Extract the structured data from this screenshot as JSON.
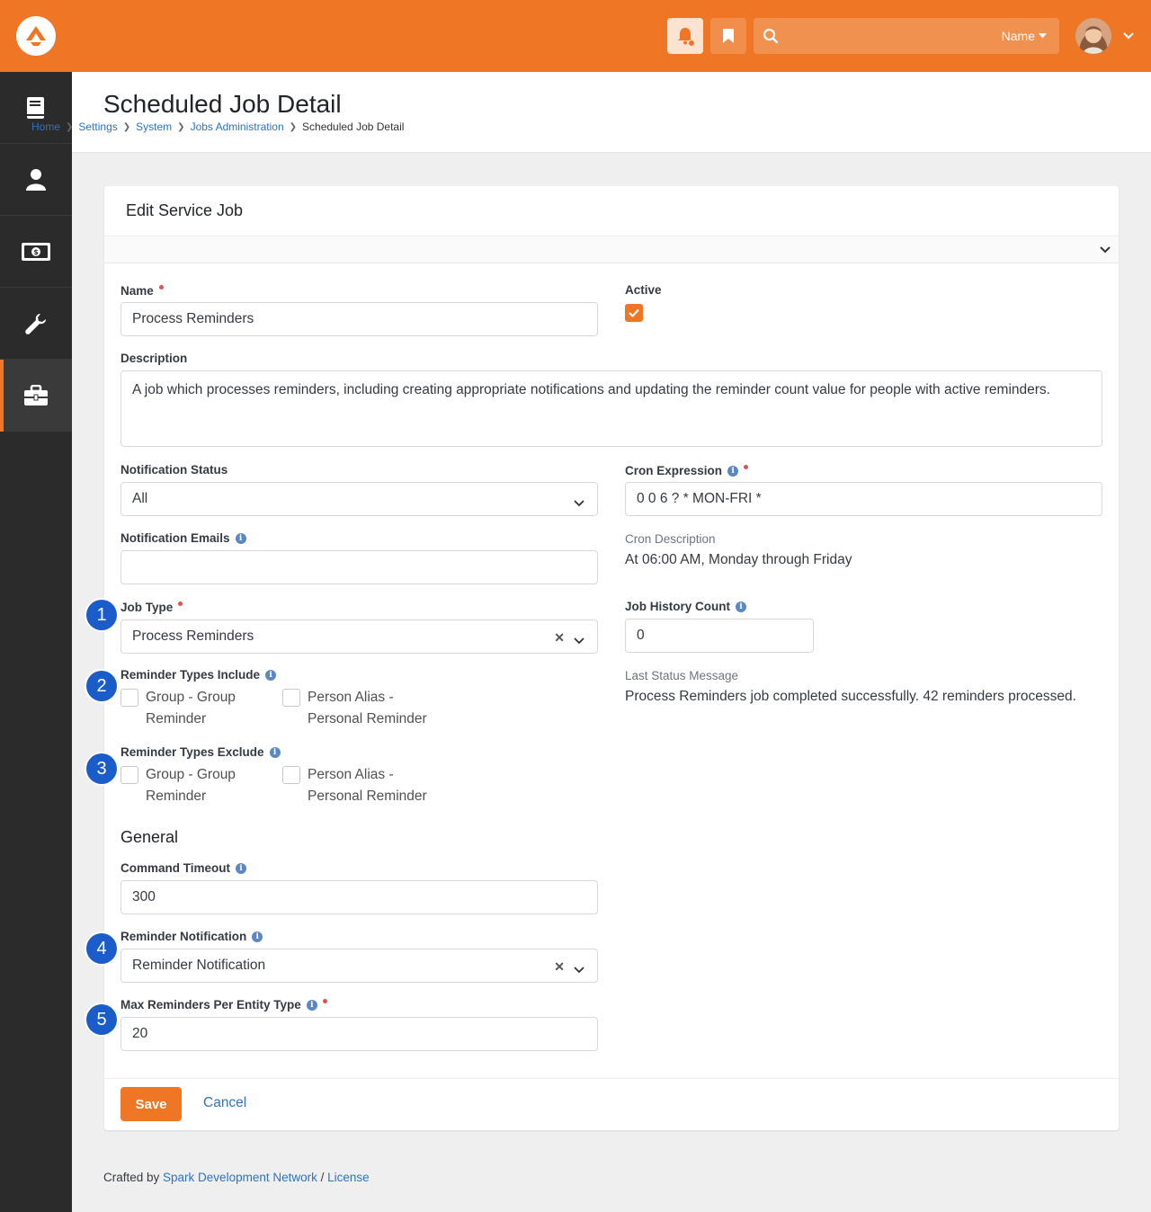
{
  "header": {
    "search_filter": "Name",
    "search_placeholder": ""
  },
  "page": {
    "title": "Scheduled Job Detail",
    "breadcrumb": [
      "Home",
      "Settings",
      "System",
      "Jobs Administration",
      "Scheduled Job Detail"
    ]
  },
  "panel": {
    "title": "Edit Service Job"
  },
  "form": {
    "name_label": "Name",
    "name_value": "Process Reminders",
    "active_label": "Active",
    "active_checked": true,
    "description_label": "Description",
    "description_value": "A job which processes reminders, including creating appropriate notifications and updating the reminder count value for people with active reminders.",
    "notification_status_label": "Notification Status",
    "notification_status_value": "All",
    "cron_expression_label": "Cron Expression",
    "cron_expression_value": "0 0 6 ? * MON-FRI *",
    "notification_emails_label": "Notification Emails",
    "notification_emails_value": "",
    "cron_description_label": "Cron Description",
    "cron_description_value": "At 06:00 AM, Monday through Friday",
    "job_type_label": "Job Type",
    "job_type_value": "Process Reminders",
    "job_history_count_label": "Job History Count",
    "job_history_count_value": "0",
    "reminder_types_include_label": "Reminder Types Include",
    "reminder_types_include_options": [
      {
        "line1": "Group - Group",
        "line2": "Reminder",
        "checked": false
      },
      {
        "line1": "Person Alias -",
        "line2": "Personal Reminder",
        "checked": false
      }
    ],
    "last_status_label": "Last Status Message",
    "last_status_value": "Process Reminders job completed successfully. 42 reminders processed.",
    "reminder_types_exclude_label": "Reminder Types Exclude",
    "reminder_types_exclude_options": [
      {
        "line1": "Group - Group",
        "line2": "Reminder",
        "checked": false
      },
      {
        "line1": "Person Alias -",
        "line2": "Personal Reminder",
        "checked": false
      }
    ],
    "general_title": "General",
    "command_timeout_label": "Command Timeout",
    "command_timeout_value": "300",
    "reminder_notification_label": "Reminder Notification",
    "reminder_notification_value": "Reminder Notification",
    "max_reminders_label": "Max Reminders Per Entity Type",
    "max_reminders_value": "20"
  },
  "callouts": [
    "1",
    "2",
    "3",
    "4",
    "5"
  ],
  "actions": {
    "save_label": "Save",
    "cancel_label": "Cancel"
  },
  "footer": {
    "prefix": "Crafted by ",
    "org_link": "Spark Development Network",
    "separator": " / ",
    "license_link": "License"
  },
  "colors": {
    "brand": "#ee7625",
    "sidebar": "#2b2b2b",
    "link": "#2c73c5",
    "callout": "#1a5cc9",
    "required": "#d9534f"
  }
}
